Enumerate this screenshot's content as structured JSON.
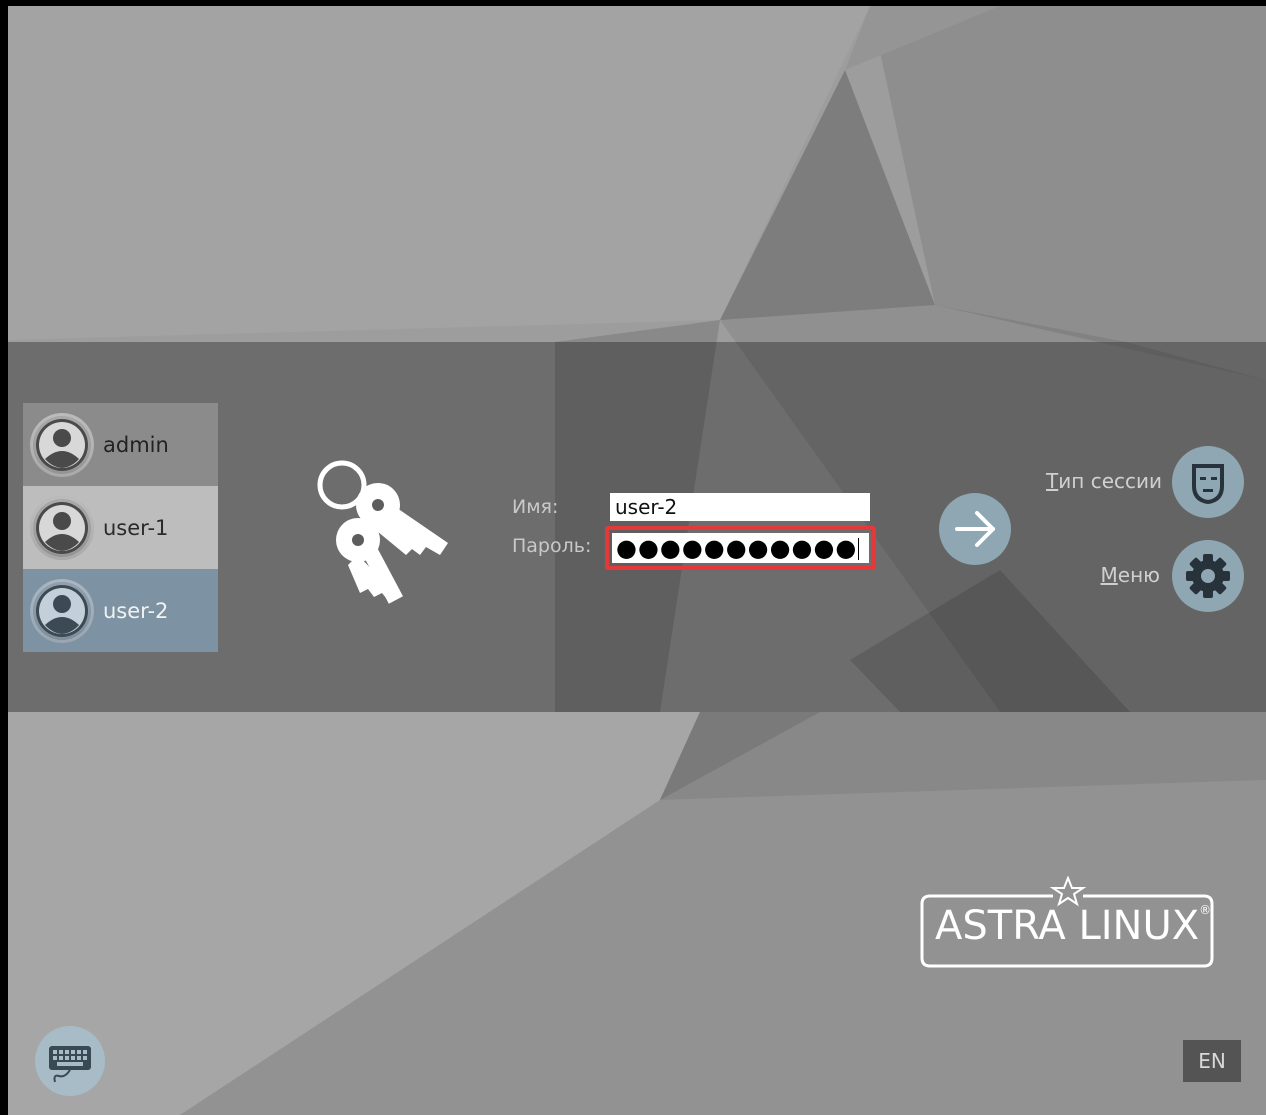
{
  "users": [
    {
      "name": "admin"
    },
    {
      "name": "user-1"
    },
    {
      "name": "user-2"
    }
  ],
  "login": {
    "name_label": "Имя:",
    "name_value": "user-2",
    "password_label": "Пароль:",
    "password_value": "●●●●●●●●●●●",
    "submit_icon": "arrow-right-icon"
  },
  "side": {
    "session_type_first": "Т",
    "session_type_rest": "ип сессии",
    "session_icon": "theater-mask-icon",
    "menu_first": "М",
    "menu_rest": "еню",
    "menu_icon": "gear-icon"
  },
  "brand": {
    "logo_text": "ASTRA LINUX",
    "logo_mark": "®"
  },
  "footer": {
    "keyboard_icon": "keyboard-icon",
    "language": "EN"
  },
  "colors": {
    "selected_user": "#7d93a4",
    "highlight_border": "#e5383b",
    "button_fill": "#8fa7b3"
  }
}
